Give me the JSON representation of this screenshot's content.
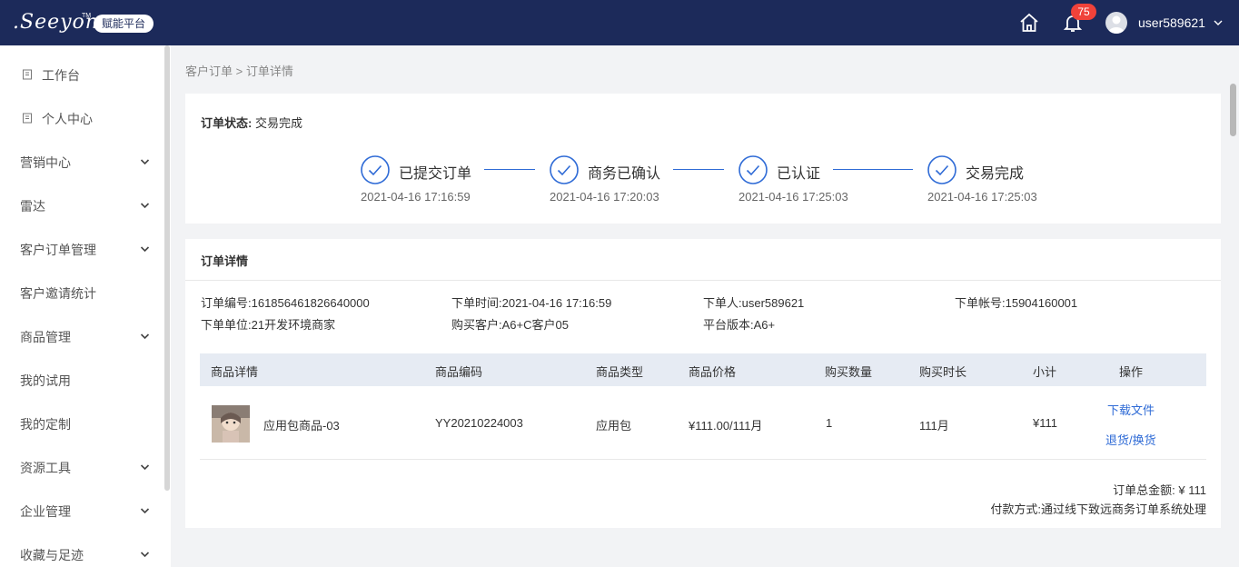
{
  "header": {
    "logo": ".Seeyon",
    "logo_tm": "TM",
    "platform_badge": "赋能平台",
    "notification_count": "75",
    "username": "user589621"
  },
  "sidebar": {
    "items": [
      {
        "label": "工作台",
        "icon": "doc-icon",
        "expandable": false
      },
      {
        "label": "个人中心",
        "icon": "doc-icon",
        "expandable": false
      },
      {
        "label": "营销中心",
        "expandable": true
      },
      {
        "label": "雷达",
        "expandable": true
      },
      {
        "label": "客户订单管理",
        "expandable": true
      },
      {
        "label": "客户邀请统计",
        "expandable": false
      },
      {
        "label": "商品管理",
        "expandable": true
      },
      {
        "label": "我的试用",
        "expandable": false
      },
      {
        "label": "我的定制",
        "expandable": false
      },
      {
        "label": "资源工具",
        "expandable": true
      },
      {
        "label": "企业管理",
        "expandable": true
      },
      {
        "label": "收藏与足迹",
        "expandable": true
      }
    ]
  },
  "breadcrumb": "客户订单 > 订单详情",
  "status": {
    "label": "订单状态:",
    "value": "交易完成",
    "steps": [
      {
        "title": "已提交订单",
        "time": "2021-04-16 17:16:59"
      },
      {
        "title": "商务已确认",
        "time": "2021-04-16 17:20:03"
      },
      {
        "title": "已认证",
        "time": "2021-04-16 17:25:03"
      },
      {
        "title": "交易完成",
        "time": "2021-04-16 17:25:03"
      }
    ]
  },
  "detail": {
    "title": "订单详情",
    "info": {
      "order_no": "订单编号:161856461826640000",
      "order_time": "下单时间:2021-04-16 17:16:59",
      "orderer": "下单人:user589621",
      "account": "下单帐号:15904160001",
      "unit": "下单单位:21开发环境商家",
      "customer": "购买客户:A6+C客户05",
      "platform": "平台版本:A6+"
    },
    "columns": [
      "商品详情",
      "商品编码",
      "商品类型",
      "商品价格",
      "购买数量",
      "购买时长",
      "小计",
      "操作"
    ],
    "rows": [
      {
        "name": "应用包商品-03",
        "code": "YY20210224003",
        "type": "应用包",
        "price": "¥111.00/111月",
        "quantity": "1",
        "duration": "111月",
        "subtotal": "¥111",
        "actions": [
          "下载文件",
          "退货/换货"
        ]
      }
    ],
    "total": "订单总金额: ¥ 111",
    "payment": "付款方式:通过线下致远商务订单系统处理"
  },
  "colors": {
    "header_bg": "#1c2a5a",
    "accent": "#2f6bd6",
    "badge": "#f0423a",
    "table_head_bg": "#e6ebf3"
  }
}
